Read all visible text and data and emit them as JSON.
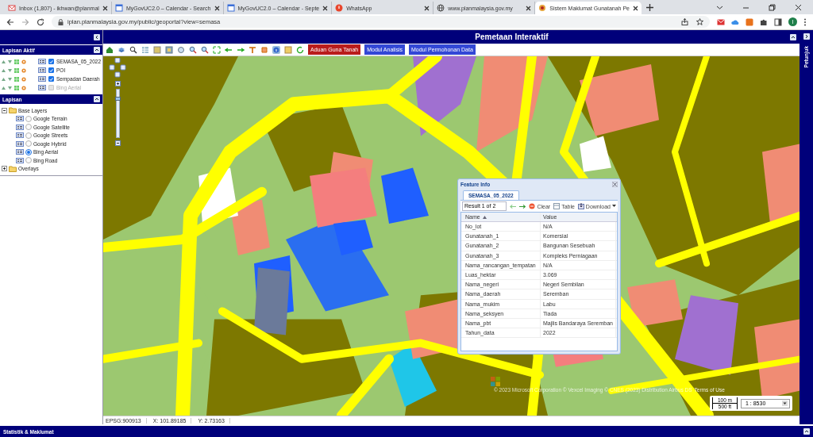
{
  "browser": {
    "tabs": [
      {
        "title": "Inbox (1,807) - ikhwan@planmal",
        "kind": "mail",
        "selected": false
      },
      {
        "title": "MyGovUC2.0 – Calendar - Search",
        "kind": "calendar",
        "selected": false
      },
      {
        "title": "MyGovUC2.0 – Calendar - Septe",
        "kind": "calendar",
        "selected": false
      },
      {
        "title": "WhatsApp",
        "kind": "chat",
        "selected": false
      },
      {
        "title": "www.planmalaysia.gov.my",
        "kind": "globe",
        "selected": false
      },
      {
        "title": "Sistem Maklumat Gunatanah Pe",
        "kind": "emblem",
        "selected": true
      }
    ],
    "url": "iplan.planmalaysia.gov.my/public/geoportal?view=semasa",
    "profile": "I"
  },
  "left_panel": {
    "active_layers": {
      "title": "Lapisan Aktif",
      "layers": [
        {
          "label": "SEMASA_05_2022",
          "checked": true,
          "disabled": false
        },
        {
          "label": "POI",
          "checked": true,
          "disabled": false
        },
        {
          "label": "Sempadan Daerah",
          "checked": true,
          "disabled": false
        },
        {
          "label": "Bing Aerial",
          "checked": false,
          "disabled": true
        }
      ]
    },
    "layers": {
      "title": "Lapisan",
      "tree": [
        {
          "label": "Base Layers",
          "expanded": true,
          "children": [
            {
              "label": "Google Terrain",
              "selected": false
            },
            {
              "label": "Google Satellite",
              "selected": false
            },
            {
              "label": "Google Streets",
              "selected": false
            },
            {
              "label": "Google Hybrid",
              "selected": false
            },
            {
              "label": "Bing Aerial",
              "selected": true
            },
            {
              "label": "Bing Road",
              "selected": false
            }
          ]
        },
        {
          "label": "Overlays",
          "expanded": false
        }
      ]
    }
  },
  "map_panel": {
    "title": "Pemetaan Interaktif",
    "toolbar_buttons": [
      {
        "label": "Aduan Guna Tanah",
        "kind": "alert"
      },
      {
        "label": "Modul Analisis",
        "kind": "module"
      },
      {
        "label": "Modul Permohonan Data",
        "kind": "module"
      }
    ],
    "zoom_slider": {
      "level": 0.8
    },
    "feature_info": {
      "title": "Feature Info",
      "tabs": [
        {
          "label": "SEMASA_05_2022",
          "selected": true
        }
      ],
      "result": "Result 1 of 2",
      "actions": [
        "Clear",
        "Table",
        "Download"
      ],
      "columns": [
        {
          "label": "Name",
          "sorted": true
        },
        {
          "label": "Value",
          "sorted": false
        }
      ],
      "rows": [
        [
          "No_lot",
          "N/A"
        ],
        [
          "Gunatanah_1",
          "Komersial"
        ],
        [
          "Gunatanah_2",
          "Bangunan Sesebuah"
        ],
        [
          "Gunatanah_3",
          "Kompleks Perniagaan"
        ],
        [
          "Nama_rancangan_tempatan",
          "N/A"
        ],
        [
          "Luas_hektar",
          "3.069"
        ],
        [
          "Nama_negeri",
          "Negeri Sembilan"
        ],
        [
          "Nama_daerah",
          "Seremban"
        ],
        [
          "Nama_mukim",
          "Labu"
        ],
        [
          "Nama_seksyen",
          "Tiada"
        ],
        [
          "Nama_pbt",
          "Majlis Bandaraya Seremban"
        ],
        [
          "Tahun_data",
          "2022"
        ]
      ]
    },
    "attribution": "© 2023 Microsoft Corporation © Vexcel Imaging © CNES (2023) Distribution Airbus DS",
    "terms": "Terms of Use",
    "scale_line": [
      "100 m",
      "500 ft"
    ],
    "scale": "1 : 8530",
    "status": [
      "EPSG:900913",
      "X: 101.89185",
      "Y: 2.73163"
    ]
  },
  "right_panel": {
    "title": "Petunjuk"
  },
  "bottom_panel": {
    "title": "Statistik & Maklumat"
  }
}
